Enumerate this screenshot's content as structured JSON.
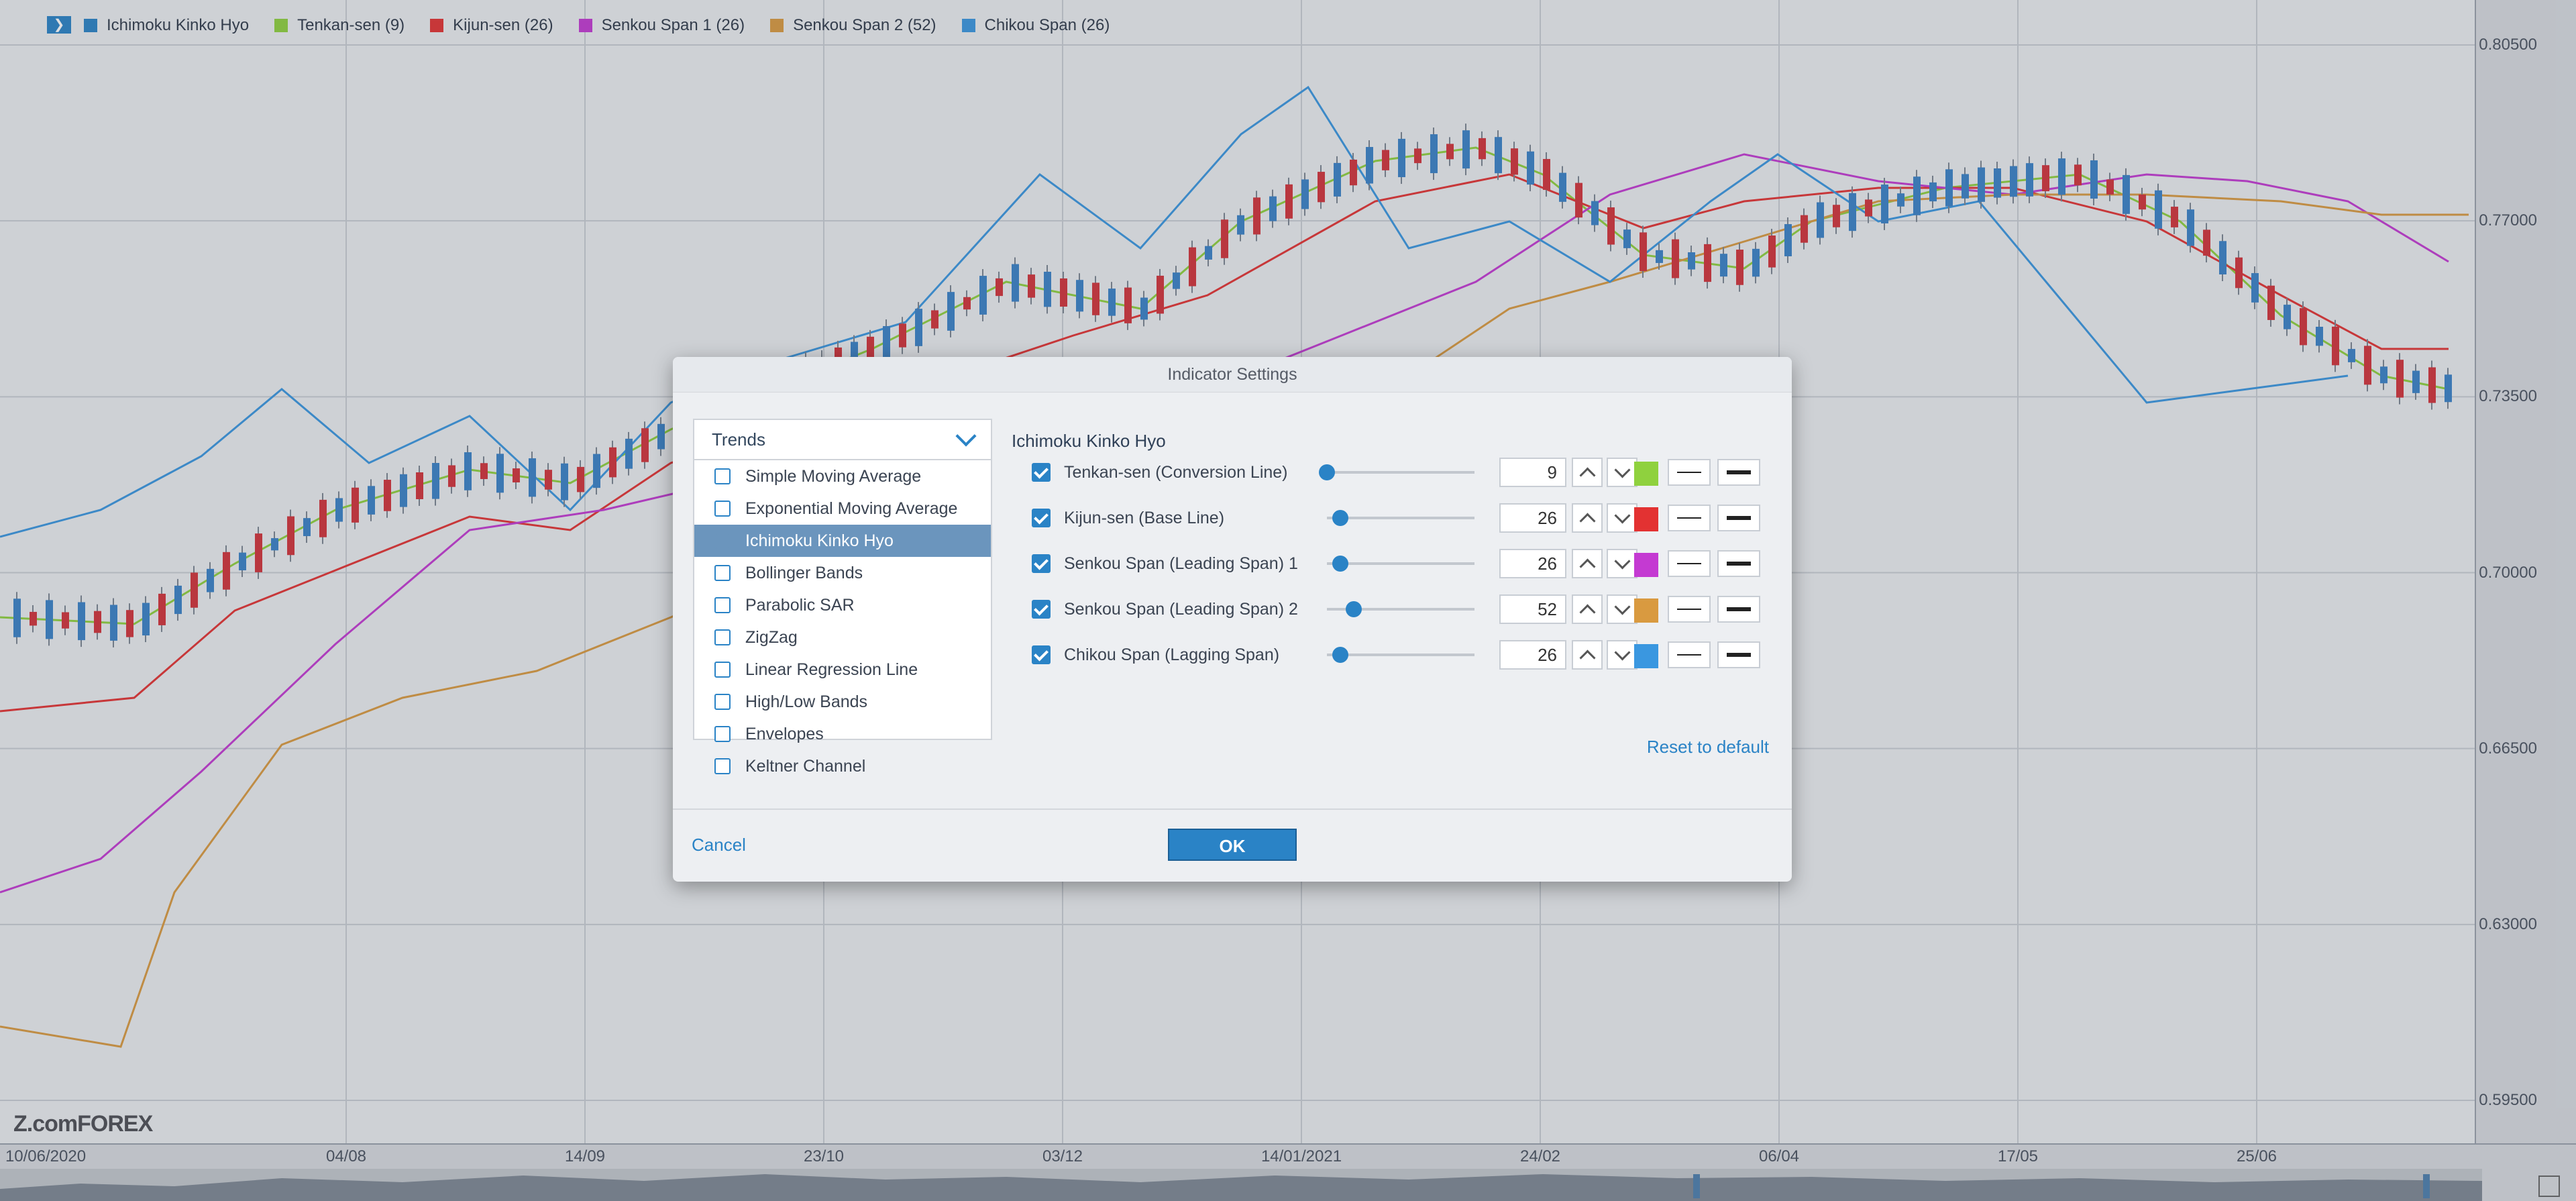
{
  "legend": {
    "collapse_icon": "chevron-right-icon",
    "items": [
      {
        "label": "Ichimoku Kinko Hyo",
        "color": "#2a83c6"
      },
      {
        "label": "Tenkan-sen (9)",
        "color": "#8fd13e"
      },
      {
        "label": "Kijun-sen (26)",
        "color": "#e33232"
      },
      {
        "label": "Senkou Span 1 (26)",
        "color": "#c43ad2"
      },
      {
        "label": "Senkou Span 2 (52)",
        "color": "#d99a40"
      },
      {
        "label": "Chikou Span (26)",
        "color": "#3a97e0"
      }
    ]
  },
  "brand": {
    "prefix": "Z.com",
    "suffix": "FOREX"
  },
  "chart_data": {
    "type": "line",
    "y_ticks": [
      "0.80500",
      "0.77000",
      "0.73500",
      "0.70000",
      "0.66500",
      "0.63000",
      "0.59500"
    ],
    "x_ticks": [
      "10/06/2020",
      "04/08",
      "14/09",
      "23/10",
      "03/12",
      "14/01/2021",
      "24/02",
      "06/04",
      "17/05",
      "25/06"
    ],
    "ylim": [
      0.595,
      0.805
    ],
    "series": [
      {
        "name": "Tenkan-sen (9)",
        "color": "#8fd13e"
      },
      {
        "name": "Kijun-sen (26)",
        "color": "#e33232"
      },
      {
        "name": "Senkou Span 1 (26)",
        "color": "#c43ad2"
      },
      {
        "name": "Senkou Span 2 (52)",
        "color": "#d99a40"
      },
      {
        "name": "Chikou Span (26)",
        "color": "#3a97e0"
      }
    ]
  },
  "dialog": {
    "title": "Indicator Settings",
    "category": "Trends",
    "indicators": [
      {
        "label": "Simple Moving Average",
        "active": false
      },
      {
        "label": "Exponential Moving Average",
        "active": false
      },
      {
        "label": "Ichimoku Kinko Hyo",
        "active": true
      },
      {
        "label": "Bollinger Bands",
        "active": false
      },
      {
        "label": "Parabolic SAR",
        "active": false
      },
      {
        "label": "ZigZag",
        "active": false
      },
      {
        "label": "Linear Regression Line",
        "active": false
      },
      {
        "label": "High/Low Bands",
        "active": false
      },
      {
        "label": "Envelopes",
        "active": false
      },
      {
        "label": "Keltner Channel",
        "active": false
      }
    ],
    "panel_title": "Ichimoku Kinko Hyo",
    "settings": [
      {
        "label": "Tenkan-sen (Conversion Line)",
        "value": "9",
        "color": "#8fd13e",
        "slider": 0.0
      },
      {
        "label": "Kijun-sen (Base Line)",
        "value": "26",
        "color": "#e33232",
        "slider": 0.09
      },
      {
        "label": "Senkou Span (Leading Span) 1",
        "value": "26",
        "color": "#c43ad2",
        "slider": 0.09
      },
      {
        "label": "Senkou Span (Leading Span) 2",
        "value": "52",
        "color": "#d99a40",
        "slider": 0.18
      },
      {
        "label": "Chikou Span (Lagging Span)",
        "value": "26",
        "color": "#3a97e0",
        "slider": 0.09
      }
    ],
    "reset_label": "Reset to default",
    "cancel_label": "Cancel",
    "ok_label": "OK"
  }
}
